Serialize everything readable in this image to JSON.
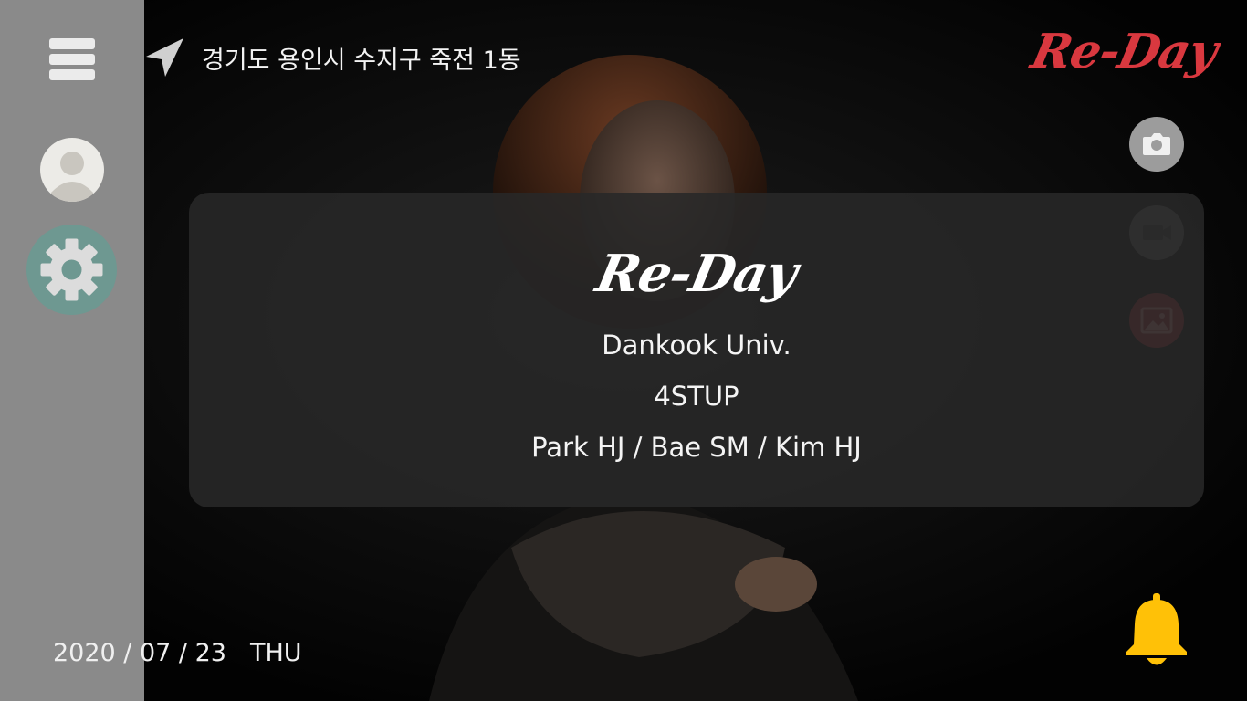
{
  "header": {
    "location": "경기도 용인시 수지구 죽전 1동",
    "logo": "Re-Day"
  },
  "sidebar": {
    "menu_icon": "hamburger-icon",
    "profile_icon": "user-avatar-icon",
    "settings_icon": "gear-icon",
    "color": "#8a8a8a"
  },
  "actions": {
    "camera_icon": "camera-icon",
    "video_icon": "video-camera-icon",
    "gallery_icon": "image-icon",
    "notification_icon": "bell-icon"
  },
  "panel": {
    "logo": "Re-Day",
    "university": "Dankook Univ.",
    "team": "4STUP",
    "members": "Park HJ / Bae SM / Kim HJ"
  },
  "footer": {
    "date": "2020 / 07 / 23",
    "day": "THU"
  },
  "colors": {
    "accent": "#d9383f",
    "bell": "#ffc107",
    "settings": "#6e9891"
  }
}
